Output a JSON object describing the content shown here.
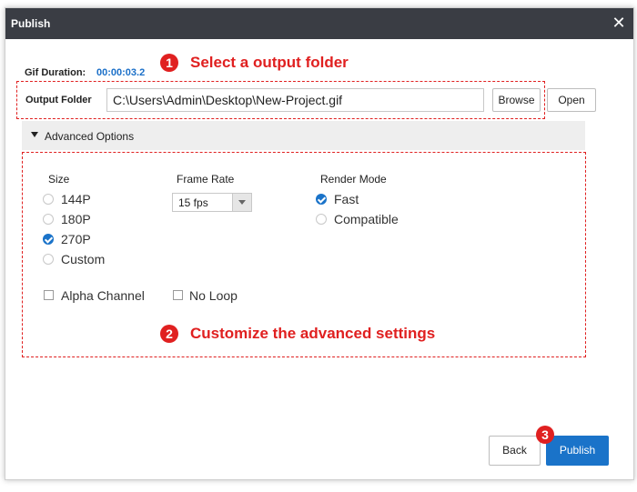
{
  "window": {
    "title": "Publish",
    "close_glyph": "✕"
  },
  "gif_duration": {
    "label": "Gif Duration:",
    "value": "00:00:03.2"
  },
  "output_folder": {
    "label": "Output Folder",
    "path": "C:\\Users\\Admin\\Desktop\\New-Project.gif",
    "browse_label": "Browse",
    "open_label": "Open"
  },
  "advanced": {
    "header_label": "Advanced Options",
    "size": {
      "label": "Size",
      "options": [
        "144P",
        "180P",
        "270P",
        "Custom"
      ],
      "selected": "270P"
    },
    "frame_rate": {
      "label": "Frame Rate",
      "value": "15 fps"
    },
    "render_mode": {
      "label": "Render Mode",
      "options": [
        "Fast",
        "Compatible"
      ],
      "selected": "Fast"
    },
    "alpha_channel": {
      "label": "Alpha Channel",
      "checked": false
    },
    "no_loop": {
      "label": "No Loop",
      "checked": false
    }
  },
  "annotations": {
    "step1": {
      "number": "1",
      "text": "Select a output folder"
    },
    "step2": {
      "number": "2",
      "text": "Customize the advanced settings"
    },
    "step3": {
      "number": "3"
    }
  },
  "footer": {
    "back_label": "Back",
    "publish_label": "Publish"
  },
  "colors": {
    "accent": "#1a73c9",
    "annotation": "#e02020",
    "titlebar": "#3a3d44"
  }
}
